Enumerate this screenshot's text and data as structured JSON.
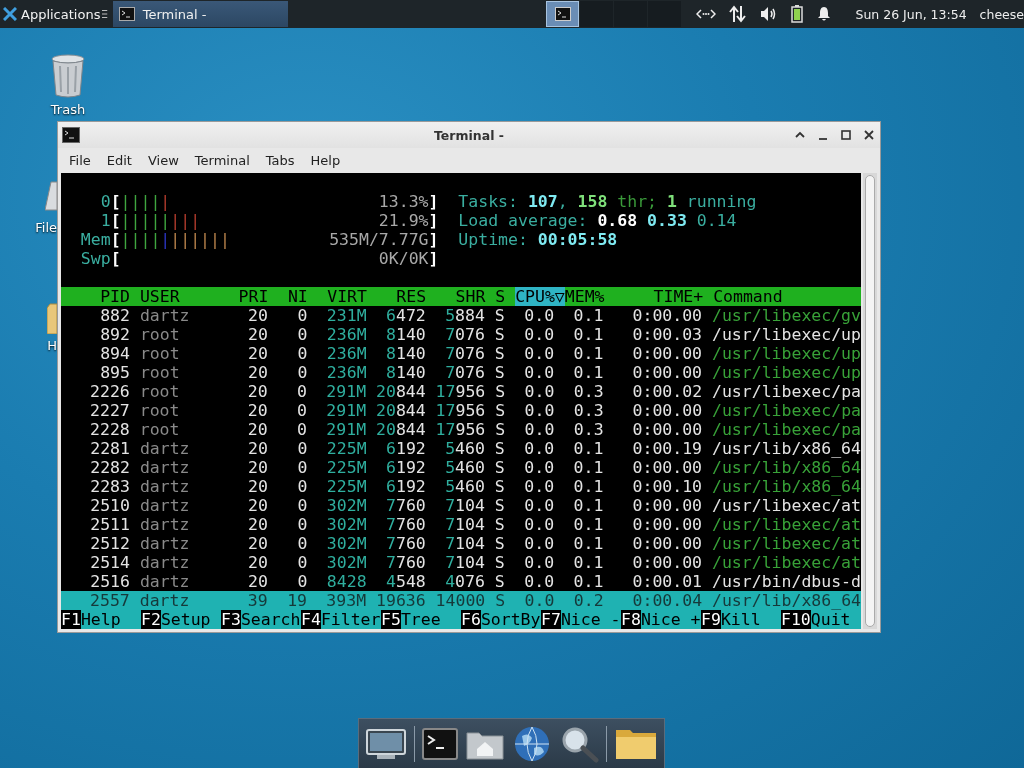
{
  "panel": {
    "app_menu": "Applications",
    "tasks": [
      {
        "title": "Terminal -",
        "selected": true
      }
    ],
    "workspaces": [
      {
        "selected": true
      },
      {
        "selected": false
      },
      {
        "selected": false
      },
      {
        "selected": false
      }
    ],
    "clock": "Sun 26 Jun, 13:54",
    "user": "cheese"
  },
  "desktop_icons": [
    {
      "label": "Trash",
      "kind": "trash"
    },
    {
      "label": "File",
      "kind": "drive"
    },
    {
      "label": "H",
      "kind": "folder"
    }
  ],
  "window": {
    "title": "Terminal -",
    "menu": [
      "File",
      "Edit",
      "View",
      "Terminal",
      "Tabs",
      "Help"
    ]
  },
  "meters": [
    {
      "label": "0",
      "open": "[",
      "close": "]",
      "reading": "13.3%",
      "segments": [
        {
          "kind": "normal",
          "text": "||||"
        },
        {
          "kind": "kernel",
          "text": "|"
        }
      ]
    },
    {
      "label": "1",
      "open": "[",
      "close": "]",
      "reading": "21.9%",
      "segments": [
        {
          "kind": "normal",
          "text": "|||||"
        },
        {
          "kind": "kernel",
          "text": "|||"
        }
      ]
    },
    {
      "label": "Mem",
      "open": "[",
      "close": "]",
      "reading": "535M/7.77G",
      "segments": [
        {
          "kind": "normal",
          "text": "||||"
        },
        {
          "kind": "buffers",
          "text": "|"
        },
        {
          "kind": "cache",
          "text": "||||||"
        }
      ]
    },
    {
      "label": "Swp",
      "open": "[",
      "close": "]",
      "reading": "0K/0K"
    }
  ],
  "summary": [
    [
      {
        "text": "Tasks:",
        "kind": "label"
      },
      {
        "text": "107",
        "kind": "bright"
      },
      {
        "text": ",",
        "kind": "label",
        "join": true
      },
      {
        "text": "158",
        "kind": "thread"
      },
      {
        "text": "thr;",
        "kind": "thread_dim"
      },
      {
        "text": "1",
        "kind": "thread"
      },
      {
        "text": "running",
        "kind": "label"
      }
    ],
    [
      {
        "text": "Load average:",
        "kind": "label"
      },
      {
        "text": "0.68",
        "kind": "white"
      },
      {
        "text": "0.33",
        "kind": "bright"
      },
      {
        "text": "0.14",
        "kind": "label"
      }
    ],
    [
      {
        "text": "Uptime:",
        "kind": "label"
      },
      {
        "text": "00:05:58",
        "kind": "bright"
      }
    ]
  ],
  "columns": [
    {
      "label": "PID",
      "sorted": false
    },
    {
      "label": "USER",
      "sorted": false
    },
    {
      "label": "PRI",
      "sorted": false
    },
    {
      "label": "NI",
      "sorted": false
    },
    {
      "label": "VIRT",
      "sorted": false
    },
    {
      "label": "RES",
      "sorted": false
    },
    {
      "label": "SHR",
      "sorted": false
    },
    {
      "label": "S",
      "sorted": false
    },
    {
      "label": "CPU%▽",
      "sorted": true
    },
    {
      "label": "MEM%",
      "sorted": false
    },
    {
      "label": "TIME+",
      "sorted": false
    },
    {
      "label": "Command",
      "sorted": false
    }
  ],
  "processes": [
    {
      "cells": [
        "882",
        "dartz",
        "20",
        "0",
        "231M",
        "6472",
        "5884",
        "S",
        "0.0",
        "0.1",
        "0:00.00",
        "/usr/libexec/gv"
      ],
      "thread": true,
      "selected": false
    },
    {
      "cells": [
        "892",
        "root",
        "20",
        "0",
        "236M",
        "8140",
        "7076",
        "S",
        "0.0",
        "0.1",
        "0:00.03",
        "/usr/libexec/up"
      ],
      "thread": false,
      "selected": false
    },
    {
      "cells": [
        "894",
        "root",
        "20",
        "0",
        "236M",
        "8140",
        "7076",
        "S",
        "0.0",
        "0.1",
        "0:00.00",
        "/usr/libexec/up"
      ],
      "thread": true,
      "selected": false
    },
    {
      "cells": [
        "895",
        "root",
        "20",
        "0",
        "236M",
        "8140",
        "7076",
        "S",
        "0.0",
        "0.1",
        "0:00.00",
        "/usr/libexec/up"
      ],
      "thread": true,
      "selected": false
    },
    {
      "cells": [
        "2226",
        "root",
        "20",
        "0",
        "291M",
        "20844",
        "17956",
        "S",
        "0.0",
        "0.3",
        "0:00.02",
        "/usr/libexec/pa"
      ],
      "thread": false,
      "selected": false
    },
    {
      "cells": [
        "2227",
        "root",
        "20",
        "0",
        "291M",
        "20844",
        "17956",
        "S",
        "0.0",
        "0.3",
        "0:00.00",
        "/usr/libexec/pa"
      ],
      "thread": true,
      "selected": false
    },
    {
      "cells": [
        "2228",
        "root",
        "20",
        "0",
        "291M",
        "20844",
        "17956",
        "S",
        "0.0",
        "0.3",
        "0:00.00",
        "/usr/libexec/pa"
      ],
      "thread": true,
      "selected": false
    },
    {
      "cells": [
        "2281",
        "dartz",
        "20",
        "0",
        "225M",
        "6192",
        "5460",
        "S",
        "0.0",
        "0.1",
        "0:00.19",
        "/usr/lib/x86_64"
      ],
      "thread": false,
      "selected": false
    },
    {
      "cells": [
        "2282",
        "dartz",
        "20",
        "0",
        "225M",
        "6192",
        "5460",
        "S",
        "0.0",
        "0.1",
        "0:00.00",
        "/usr/lib/x86_64"
      ],
      "thread": true,
      "selected": false
    },
    {
      "cells": [
        "2283",
        "dartz",
        "20",
        "0",
        "225M",
        "6192",
        "5460",
        "S",
        "0.0",
        "0.1",
        "0:00.10",
        "/usr/lib/x86_64"
      ],
      "thread": true,
      "selected": false
    },
    {
      "cells": [
        "2510",
        "dartz",
        "20",
        "0",
        "302M",
        "7760",
        "7104",
        "S",
        "0.0",
        "0.1",
        "0:00.00",
        "/usr/libexec/at"
      ],
      "thread": false,
      "selected": false
    },
    {
      "cells": [
        "2511",
        "dartz",
        "20",
        "0",
        "302M",
        "7760",
        "7104",
        "S",
        "0.0",
        "0.1",
        "0:00.00",
        "/usr/libexec/at"
      ],
      "thread": true,
      "selected": false
    },
    {
      "cells": [
        "2512",
        "dartz",
        "20",
        "0",
        "302M",
        "7760",
        "7104",
        "S",
        "0.0",
        "0.1",
        "0:00.00",
        "/usr/libexec/at"
      ],
      "thread": true,
      "selected": false
    },
    {
      "cells": [
        "2514",
        "dartz",
        "20",
        "0",
        "302M",
        "7760",
        "7104",
        "S",
        "0.0",
        "0.1",
        "0:00.00",
        "/usr/libexec/at"
      ],
      "thread": true,
      "selected": false
    },
    {
      "cells": [
        "2516",
        "dartz",
        "20",
        "0",
        "8428",
        "4548",
        "4076",
        "S",
        "0.0",
        "0.1",
        "0:00.01",
        "/usr/bin/dbus-d"
      ],
      "thread": false,
      "selected": false
    },
    {
      "cells": [
        "2557",
        "dartz",
        "39",
        "19",
        "393M",
        "19636",
        "14000",
        "S",
        "0.0",
        "0.2",
        "0:00.04",
        "/usr/lib/x86_64"
      ],
      "thread": false,
      "selected": true
    }
  ],
  "function_keys": [
    {
      "key": "F1",
      "label": "Help"
    },
    {
      "key": "F2",
      "label": "Setup"
    },
    {
      "key": "F3",
      "label": "Search"
    },
    {
      "key": "F4",
      "label": "Filter"
    },
    {
      "key": "F5",
      "label": "Tree"
    },
    {
      "key": "F6",
      "label": "SortBy"
    },
    {
      "key": "F7",
      "label": "Nice -"
    },
    {
      "key": "F8",
      "label": "Nice +"
    },
    {
      "key": "F9",
      "label": "Kill"
    },
    {
      "key": "F10",
      "label": "Quit"
    }
  ],
  "dock": [
    {
      "kind": "monitor"
    },
    {
      "kind": "terminal"
    },
    {
      "kind": "home"
    },
    {
      "kind": "globe"
    },
    {
      "kind": "search"
    },
    {
      "kind": "folder"
    }
  ]
}
